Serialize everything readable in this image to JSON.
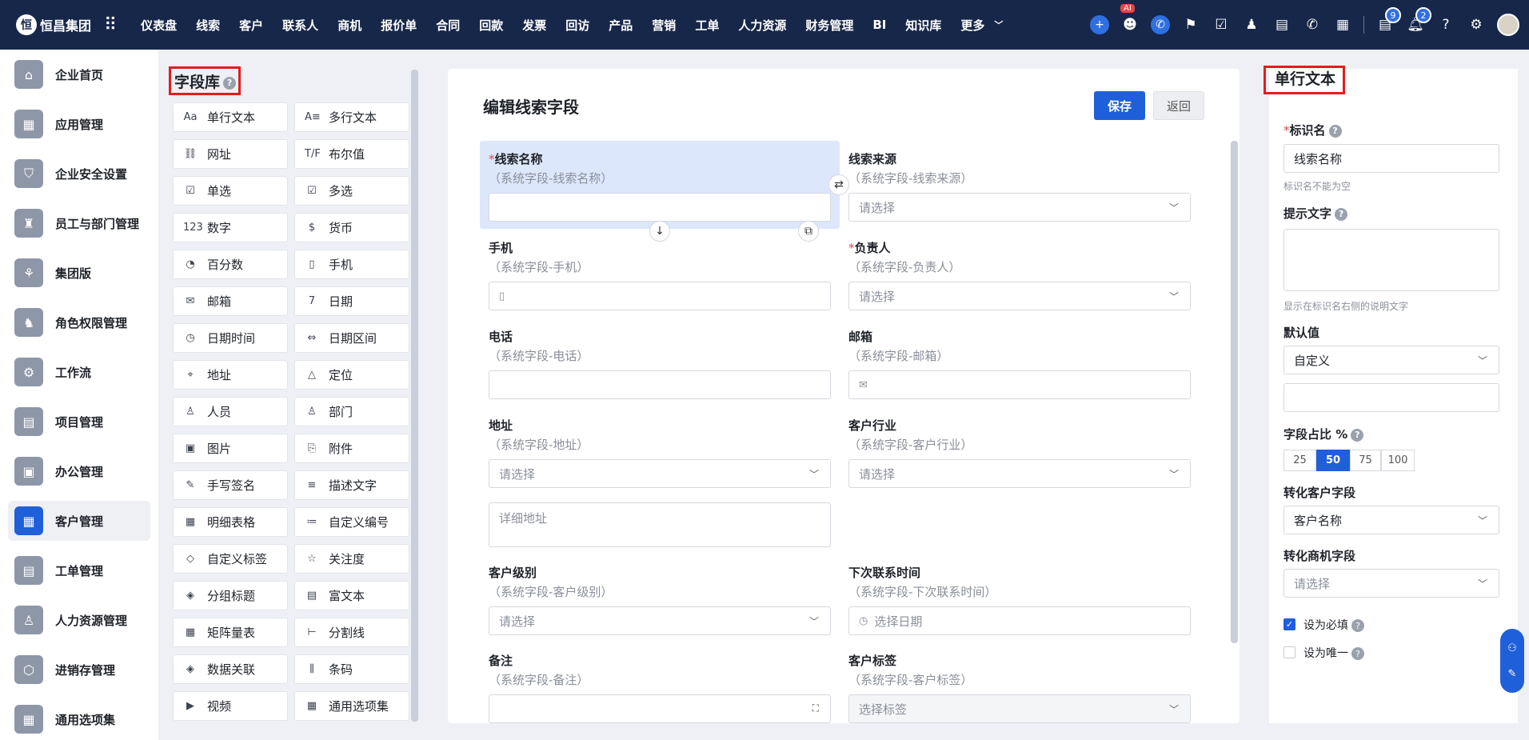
{
  "app": {
    "logo_text": "恒昌集团",
    "logo_glyph": "恒"
  },
  "nav": [
    "仪表盘",
    "线索",
    "客户",
    "联系人",
    "商机",
    "报价单",
    "合同",
    "回款",
    "发票",
    "回访",
    "产品",
    "营销",
    "工单",
    "人力资源",
    "财务管理",
    "BI",
    "知识库",
    "更多"
  ],
  "top": {
    "ai_label": "AI",
    "badge_tasks": "9",
    "badge_notify": "2"
  },
  "sidebar": [
    {
      "label": "企业首页",
      "icon": "home-icon"
    },
    {
      "label": "应用管理",
      "icon": "apps-icon"
    },
    {
      "label": "企业安全设置",
      "icon": "shield-icon"
    },
    {
      "label": "员工与部门管理",
      "icon": "org-icon"
    },
    {
      "label": "集团版",
      "icon": "group-icon"
    },
    {
      "label": "角色权限管理",
      "icon": "role-icon"
    },
    {
      "label": "工作流",
      "icon": "workflow-icon"
    },
    {
      "label": "项目管理",
      "icon": "project-icon"
    },
    {
      "label": "办公管理",
      "icon": "office-icon"
    },
    {
      "label": "客户管理",
      "icon": "customer-icon"
    },
    {
      "label": "工单管理",
      "icon": "ticket-icon"
    },
    {
      "label": "人力资源管理",
      "icon": "hr-icon"
    },
    {
      "label": "进销存管理",
      "icon": "inventory-icon"
    },
    {
      "label": "通用选项集",
      "icon": "options-icon"
    }
  ],
  "fieldlib": {
    "title": "字段库",
    "items": [
      {
        "label": "单行文本",
        "icon": "Aa"
      },
      {
        "label": "多行文本",
        "icon": "A≡"
      },
      {
        "label": "网址",
        "icon": "⛓"
      },
      {
        "label": "布尔值",
        "icon": "T/F"
      },
      {
        "label": "单选",
        "icon": "☑"
      },
      {
        "label": "多选",
        "icon": "☑"
      },
      {
        "label": "数字",
        "icon": "123"
      },
      {
        "label": "货币",
        "icon": "$"
      },
      {
        "label": "百分数",
        "icon": "◔"
      },
      {
        "label": "手机",
        "icon": "▯"
      },
      {
        "label": "邮箱",
        "icon": "✉"
      },
      {
        "label": "日期",
        "icon": "7"
      },
      {
        "label": "日期时间",
        "icon": "◷"
      },
      {
        "label": "日期区间",
        "icon": "⇔"
      },
      {
        "label": "地址",
        "icon": "⌖"
      },
      {
        "label": "定位",
        "icon": "△"
      },
      {
        "label": "人员",
        "icon": "♙"
      },
      {
        "label": "部门",
        "icon": "♙"
      },
      {
        "label": "图片",
        "icon": "▣"
      },
      {
        "label": "附件",
        "icon": "⎘"
      },
      {
        "label": "手写签名",
        "icon": "✎"
      },
      {
        "label": "描述文字",
        "icon": "≡"
      },
      {
        "label": "明细表格",
        "icon": "▦"
      },
      {
        "label": "自定义编号",
        "icon": "≔"
      },
      {
        "label": "自定义标签",
        "icon": "◇"
      },
      {
        "label": "关注度",
        "icon": "☆"
      },
      {
        "label": "分组标题",
        "icon": "◈"
      },
      {
        "label": "富文本",
        "icon": "▤"
      },
      {
        "label": "矩阵量表",
        "icon": "▦"
      },
      {
        "label": "分割线",
        "icon": "⊢"
      },
      {
        "label": "数据关联",
        "icon": "◈"
      },
      {
        "label": "条码",
        "icon": "⫼"
      },
      {
        "label": "视频",
        "icon": "▶"
      },
      {
        "label": "通用选项集",
        "icon": "▦"
      }
    ]
  },
  "editor": {
    "title": "编辑线索字段",
    "save": "保存",
    "back": "返回",
    "fields": [
      {
        "label": "线索名称",
        "sub": "（系统字段-线索名称）",
        "required": true,
        "ph": ""
      },
      {
        "label": "线索来源",
        "sub": "（系统字段-线索来源）",
        "required": false,
        "ph": "请选择"
      },
      {
        "label": "手机",
        "sub": "（系统字段-手机）",
        "required": false,
        "ph": ""
      },
      {
        "label": "负责人",
        "sub": "（系统字段-负责人）",
        "required": true,
        "ph": "请选择"
      },
      {
        "label": "电话",
        "sub": "（系统字段-电话）",
        "required": false,
        "ph": ""
      },
      {
        "label": "邮箱",
        "sub": "（系统字段-邮箱）",
        "required": false,
        "ph": ""
      },
      {
        "label": "地址",
        "sub": "（系统字段-地址）",
        "required": false,
        "ph": "请选择"
      },
      {
        "label": "客户行业",
        "sub": "（系统字段-客户行业）",
        "required": false,
        "ph": "请选择"
      },
      {
        "label": "客户级别",
        "sub": "（系统字段-客户级别）",
        "required": false,
        "ph": "请选择"
      },
      {
        "label": "下次联系时间",
        "sub": "（系统字段-下次联系时间）",
        "required": false,
        "ph": "选择日期"
      },
      {
        "label": "备注",
        "sub": "（系统字段-备注）",
        "required": false,
        "ph": ""
      },
      {
        "label": "客户标签",
        "sub": "（系统字段-客户标签）",
        "required": false,
        "ph": "选择标签"
      }
    ],
    "address_detail_ph": "详细地址"
  },
  "props": {
    "title": "单行文本",
    "name_label": "标识名",
    "name_value": "线索名称",
    "name_hint": "标识名不能为空",
    "tip_label": "提示文字",
    "tip_hint": "显示在标识名右侧的说明文字",
    "default_label": "默认值",
    "default_value": "自定义",
    "ratio_label": "字段占比 %",
    "ratio_options": [
      "25",
      "50",
      "75",
      "100"
    ],
    "ratio_selected": "50",
    "convert_customer_label": "转化客户字段",
    "convert_customer_value": "客户名称",
    "convert_opp_label": "转化商机字段",
    "convert_opp_value": "请选择",
    "required_label": "设为必填",
    "required_checked": true,
    "unique_label": "设为唯一",
    "unique_checked": false
  },
  "colors": {
    "accent": "#1f5fd9",
    "topbar": "#17274a",
    "highlight": "#e01e1e"
  }
}
